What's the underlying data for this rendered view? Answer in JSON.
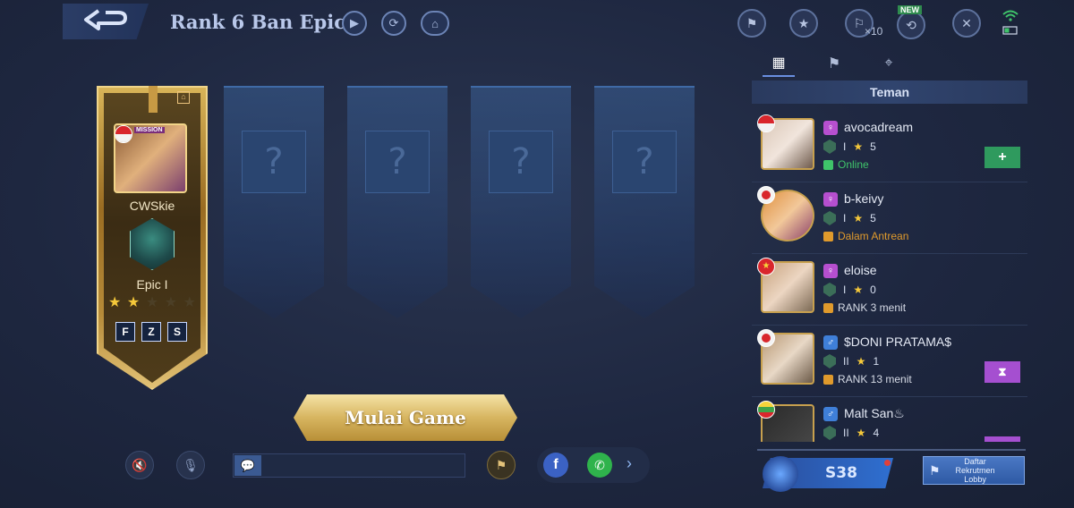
{
  "header": {
    "title": "Rank 6 Ban Epic",
    "friend_multiplier": "×10",
    "new_tag": "NEW"
  },
  "player": {
    "name": "CWSkie",
    "rank": "Epic I",
    "stars_filled": 2,
    "stars_total": 5,
    "avatar_tag": "MISSION",
    "badges": [
      "F",
      "Z",
      "S"
    ]
  },
  "slots": {
    "placeholder": "?"
  },
  "start_button": "Mulai Game",
  "friends_panel": {
    "tab_label": "Teman",
    "friends": [
      {
        "name": "avocadream",
        "gender": "♀",
        "tier": "I",
        "stars": "5",
        "status": "Online",
        "status_color": "#3fc46a",
        "action": "+"
      },
      {
        "name": "b-keivy",
        "gender": "♀",
        "tier": "I",
        "stars": "5",
        "status": "Dalam Antrean",
        "status_color": "#e09a2c"
      },
      {
        "name": "eloise",
        "gender": "♀",
        "tier": "I",
        "stars": "0",
        "status": "RANK 3 menit",
        "status_color": "#e09a2c"
      },
      {
        "name": "$DONI PRATAMA$",
        "gender": "♂",
        "tier": "II",
        "stars": "1",
        "status": "RANK 13 menit",
        "status_color": "#e09a2c",
        "action": "⧗"
      },
      {
        "name": "Malt San♨",
        "gender": "♂",
        "tier": "II",
        "stars": "4"
      }
    ]
  },
  "season_label": "S38",
  "recruit_label": "Daftar Rekrutmen Lobby",
  "colors": {
    "accent_gold": "#d7b560",
    "add_button": "#2f9a5e",
    "wait_button": "#a54fd0"
  }
}
